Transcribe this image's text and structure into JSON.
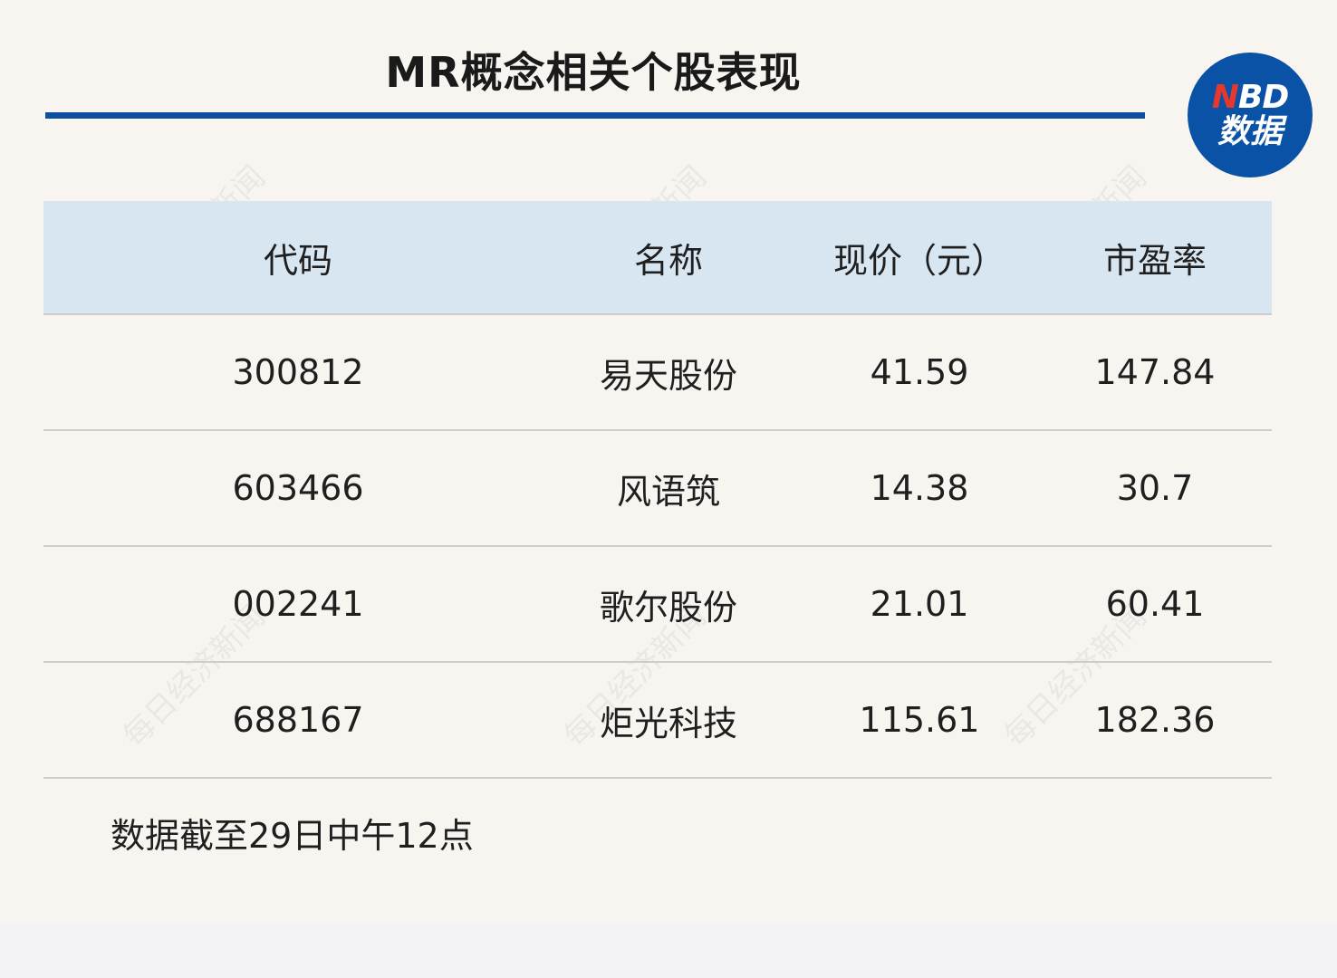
{
  "header": {
    "title": "MR概念相关个股表现",
    "logo_top": "NBD",
    "logo_bottom": "数据"
  },
  "watermark_text": "每日经济新闻",
  "table": {
    "columns": [
      "代码",
      "名称",
      "现价（元）",
      "市盈率"
    ],
    "rows": [
      {
        "code": "300812",
        "name": "易天股份",
        "price": "41.59",
        "pe": "147.84"
      },
      {
        "code": "603466",
        "name": "风语筑",
        "price": "14.38",
        "pe": "30.7"
      },
      {
        "code": "002241",
        "name": "歌尔股份",
        "price": "21.01",
        "pe": "60.41"
      },
      {
        "code": "688167",
        "name": "炬光科技",
        "price": "115.61",
        "pe": "182.36"
      }
    ]
  },
  "footnote": "数据截至29日中午12点",
  "colors": {
    "accent": "#0d4fa0",
    "header_bg": "#d8e6f1",
    "logo_bg": "#0a52a6",
    "logo_n": "#e8382e",
    "page_bg": "#f8f5f1"
  }
}
